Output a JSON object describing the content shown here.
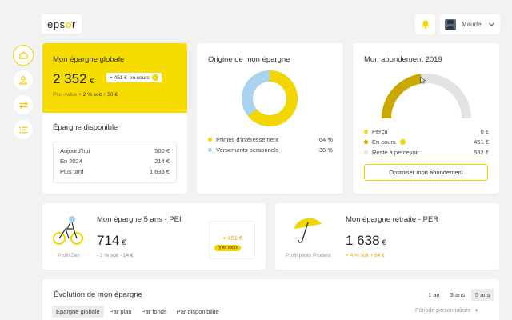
{
  "header": {
    "logo_text": "epsor",
    "user_name": "Maude"
  },
  "sidebar": {
    "items": [
      {
        "name": "home"
      },
      {
        "name": "profile"
      },
      {
        "name": "transfers"
      },
      {
        "name": "list"
      }
    ]
  },
  "global": {
    "title": "Mon épargne globale",
    "amount": "2 352",
    "currency": "€",
    "pending_badge_amount": "+ 451 €",
    "pending_badge_label": "en cours",
    "plus_value_label": "Plus-value",
    "plus_value_detail": "+ 2 % soit + 50 €"
  },
  "disponible": {
    "title": "Épargne disponible",
    "rows": [
      {
        "label": "Aujourd'hui",
        "value": "500 €"
      },
      {
        "label": "En 2024",
        "value": "214 €"
      },
      {
        "label": "Plus tard",
        "value": "1 638 €"
      }
    ]
  },
  "origine": {
    "title": "Origine de mon épargne",
    "legend": [
      {
        "label": "Primes d'intéressement",
        "value": "64 %",
        "color": "#f2d600"
      },
      {
        "label": "Versements personnels",
        "value": "36 %",
        "color": "#a9d3ee"
      }
    ]
  },
  "abondement": {
    "title": "Mon abondement 2019",
    "rows": [
      {
        "label": "Perçu",
        "value": "0 €",
        "color": "#f2d600"
      },
      {
        "label": "En cours",
        "value": "451 €",
        "color": "#c9a800"
      },
      {
        "label": "Reste à percevoir",
        "value": "532 €",
        "color": "#e3e3e3"
      }
    ],
    "gauge_fraction": 0.46,
    "button_label": "Optimiser mon abondement"
  },
  "pei": {
    "title": "Mon épargne 5 ans - PEI",
    "amount": "714",
    "currency": "€",
    "detail": "- 2 % soit - 14 €",
    "profile": "Profil Zen",
    "pending_amount": "+ 451 €",
    "pending_label": "en cours"
  },
  "per": {
    "title": "Mon épargne retraite - PER",
    "amount": "1 638",
    "currency": "€",
    "detail": "+ 4 % soit + 64 €",
    "profile": "Profil piloté Prudent"
  },
  "evolution": {
    "title": "Évolution de mon épargne",
    "periods": [
      "1 an",
      "3 ans",
      "5 ans"
    ],
    "tabs": [
      "Épargne globale",
      "Par plan",
      "Par fonds",
      "Par disponibilité"
    ],
    "custom_period": "Période personnalisée"
  },
  "colors": {
    "accent": "#f2d600",
    "dark_accent": "#c9a800",
    "blue": "#a9d3ee",
    "orange": "#e8a400"
  }
}
